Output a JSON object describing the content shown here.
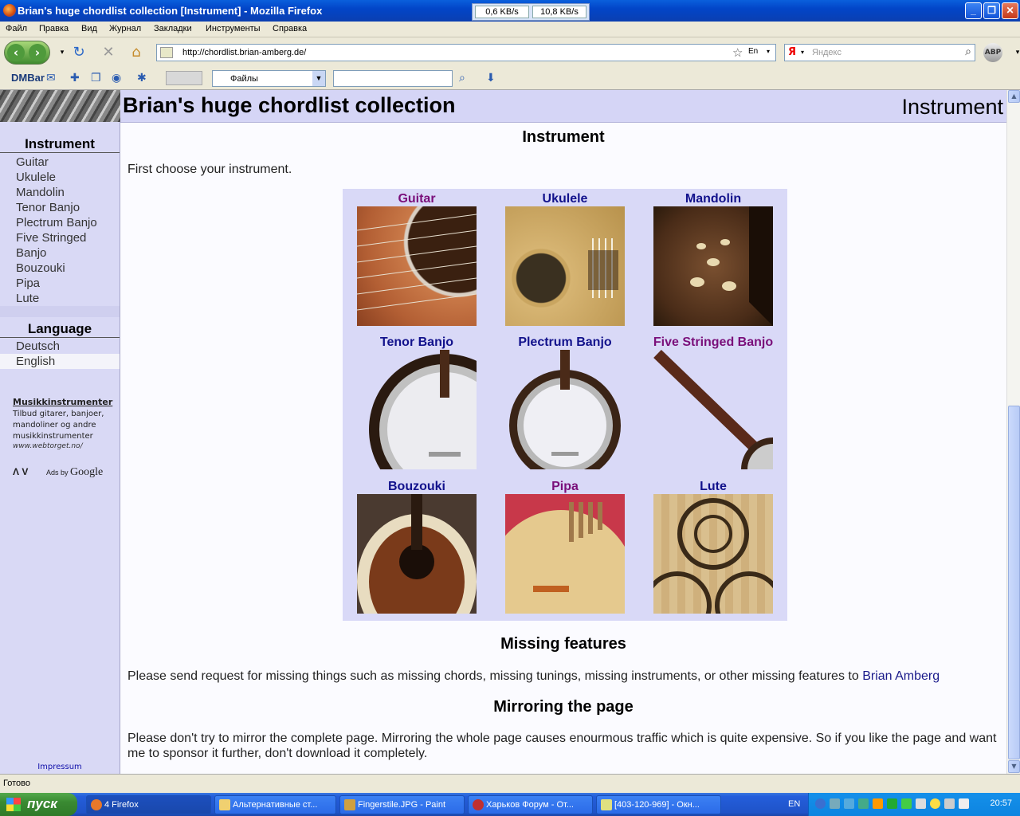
{
  "window": {
    "title": "Brian's huge chordlist collection [Instrument] - Mozilla Firefox",
    "net_down": "0,6 KB/s",
    "net_up": "10,8 KB/s"
  },
  "menu": [
    "Файл",
    "Правка",
    "Вид",
    "Журнал",
    "Закладки",
    "Инструменты",
    "Справка"
  ],
  "nav": {
    "url": "http://chordlist.brian-amberg.de/",
    "search_placeholder": "Яндекс",
    "search_logo": "Я",
    "lang_indicator": "En",
    "abp": "ABP"
  },
  "dmbar": {
    "label": "DMBar",
    "select_value": "Файлы"
  },
  "page": {
    "site_title": "Brian's huge chordlist collection",
    "header_right": "Instrument",
    "sidebar": {
      "instrument_title": "Instrument",
      "instruments": [
        "Guitar",
        "Ukulele",
        "Mandolin",
        "Tenor Banjo",
        "Plectrum Banjo",
        "Five Stringed",
        "Banjo",
        "Bouzouki",
        "Pipa",
        "Lute"
      ],
      "language_title": "Language",
      "languages": [
        "Deutsch",
        "English"
      ],
      "ad": {
        "heading": "Musikkinstrumenter",
        "text": "Tilbud gitarer, banjoer, mandoliner og andre musikkinstrumenter",
        "url": "www.webtorget.no/",
        "nav": "Λ V",
        "ads_by": "Ads by",
        "google": "Google"
      },
      "impressum": "Impressum"
    },
    "section_title": "Instrument",
    "intro": "First choose your instrument.",
    "grid": [
      {
        "label": "Guitar",
        "visited": true
      },
      {
        "label": "Ukulele",
        "visited": false
      },
      {
        "label": "Mandolin",
        "visited": false
      },
      {
        "label": "Tenor Banjo",
        "visited": false
      },
      {
        "label": "Plectrum Banjo",
        "visited": false
      },
      {
        "label": "Five Stringed Banjo",
        "visited": true
      },
      {
        "label": "Bouzouki",
        "visited": false
      },
      {
        "label": "Pipa",
        "visited": true
      },
      {
        "label": "Lute",
        "visited": false
      }
    ],
    "missing_title": "Missing features",
    "missing_text": "Please send request for missing things such as missing chords, missing tunings, missing instruments, or other missing features to",
    "missing_link": "Brian Amberg",
    "mirror_title": "Mirroring the page",
    "mirror_text": "Please don't try to mirror the complete page. Mirroring the whole page causes enourmous traffic which is quite expensive. So if you like the page and want me to sponsor it further, don't download it completely."
  },
  "status": "Готово",
  "taskbar": {
    "start": "пуск",
    "items": [
      "4 Firefox",
      "Альтернативные ст...",
      "Fingerstile.JPG - Paint",
      "Харьков Форум - От...",
      "[403-120-969] - Окн..."
    ],
    "lang": "EN",
    "clock": "20:57"
  }
}
